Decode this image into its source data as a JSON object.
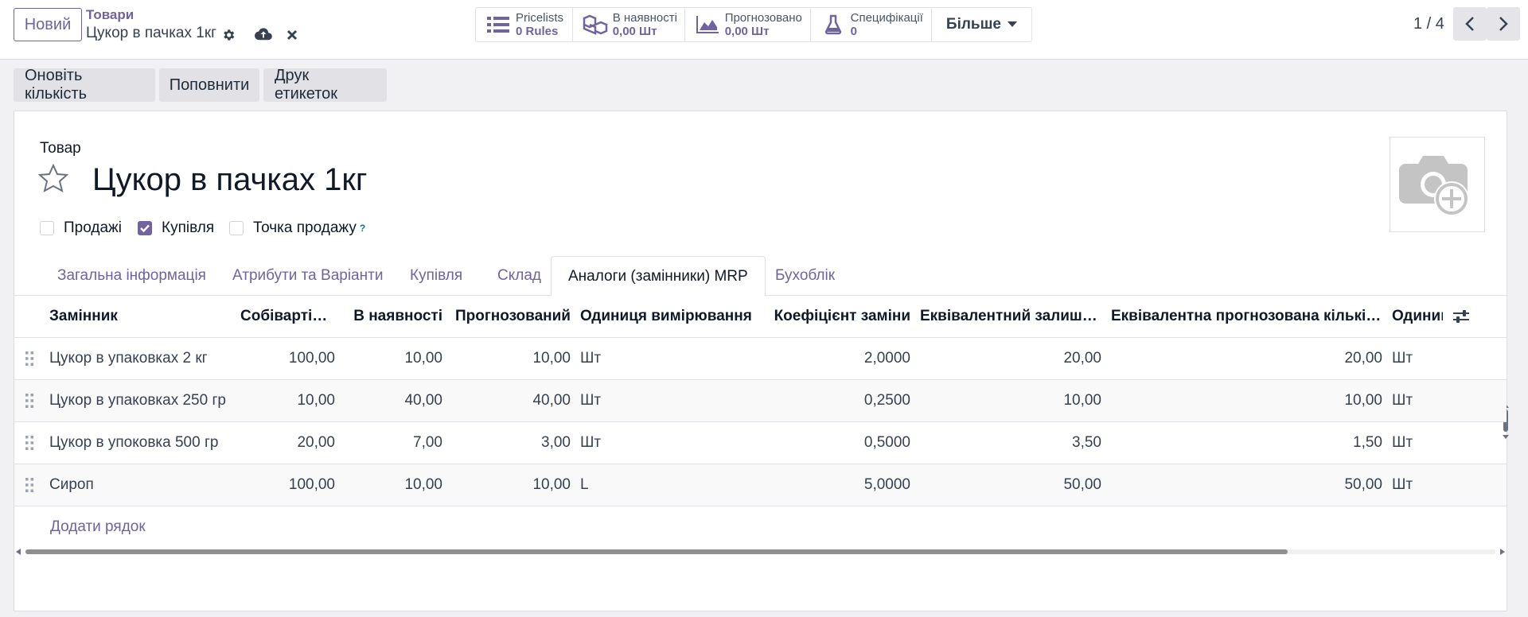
{
  "control_panel": {
    "new_button": "Новий",
    "breadcrumb_parent": "Товари",
    "breadcrumb_current": "Цукор в пачках 1кг",
    "icons": [
      "gear-icon",
      "cloud-upload-icon",
      "close-icon"
    ]
  },
  "smart_buttons": [
    {
      "label": "Pricelists",
      "value": "0  Rules",
      "icon": "list-icon"
    },
    {
      "label": "В наявності",
      "value": "0,00 Шт",
      "icon": "cubes-icon"
    },
    {
      "label": "Прогнозовано",
      "value": "0,00 Шт",
      "icon": "area-chart-icon"
    },
    {
      "label": "Специфікації",
      "value": "0",
      "icon": "flask-icon"
    }
  ],
  "more_button": "Більше",
  "pager": {
    "text": "1 / 4"
  },
  "actions": {
    "update_qty": "Оновіть кількість",
    "replenish": "Поповнити",
    "print_labels": "Друк етикеток"
  },
  "product": {
    "label": "Товар",
    "name": "Цукор в пачках 1кг",
    "checkboxes": [
      {
        "label": "Продажі",
        "checked": false
      },
      {
        "label": "Купівля",
        "checked": true
      },
      {
        "label": "Точка продажу",
        "checked": false
      }
    ],
    "tooltip_mark": "?"
  },
  "tabs": [
    {
      "label": "Загальна інформація",
      "active": false
    },
    {
      "label": "Атрибути та Варіанти",
      "active": false
    },
    {
      "label": "Купівля",
      "active": false
    },
    {
      "label": "Склад",
      "active": false
    },
    {
      "label": "Аналоги (замінники) MRP",
      "active": true
    },
    {
      "label": "Бухоблік",
      "active": false
    }
  ],
  "table": {
    "headers": [
      "Замінник",
      "Собівартість",
      "В наявності",
      "Прогнозований",
      "Одиниця вимірювання",
      "Коефіцієнт заміни",
      "Еквівалентний залишок...",
      "Еквівалентна прогнозована кількість...",
      "Одиниця"
    ],
    "rows": [
      [
        "Цукор в упаковках 2 кг",
        "100,00",
        "10,00",
        "10,00",
        "Шт",
        "2,0000",
        "20,00",
        "20,00",
        "Шт"
      ],
      [
        "Цукор в упаковках 250 гр",
        "10,00",
        "40,00",
        "40,00",
        "Шт",
        "0,2500",
        "10,00",
        "10,00",
        "Шт"
      ],
      [
        "Цукор в упоковка 500 гр",
        "20,00",
        "7,00",
        "3,00",
        "Шт",
        "0,5000",
        "3,50",
        "1,50",
        "Шт"
      ],
      [
        "Сироп",
        "100,00",
        "10,00",
        "10,00",
        "L",
        "5,0000",
        "50,00",
        "50,00",
        "Шт"
      ]
    ],
    "add_line": "Додати рядок"
  },
  "colors": {
    "accent": "#71639e",
    "background": "#f1f1f3"
  }
}
